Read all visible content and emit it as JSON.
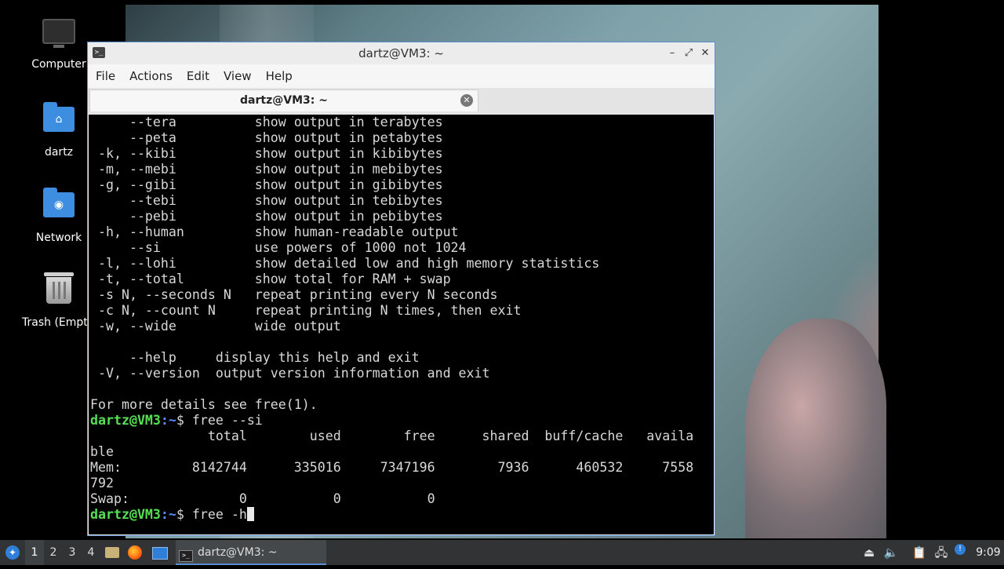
{
  "desktop": {
    "icons": [
      {
        "label": "Computer"
      },
      {
        "label": "dartz"
      },
      {
        "label": "Network"
      },
      {
        "label": "Trash (Empty)"
      }
    ]
  },
  "window": {
    "title": "dartz@VM3: ~",
    "menu": [
      "File",
      "Actions",
      "Edit",
      "View",
      "Help"
    ],
    "tab_label": "dartz@VM3: ~",
    "controls": {
      "minimize": "–",
      "maximize": "⤢",
      "close": "✕"
    }
  },
  "terminal": {
    "prompt_user": "dartz@VM3",
    "prompt_path": ":~",
    "lines": [
      "     --tera          show output in terabytes",
      "     --peta          show output in petabytes",
      " -k, --kibi          show output in kibibytes",
      " -m, --mebi          show output in mebibytes",
      " -g, --gibi          show output in gibibytes",
      "     --tebi          show output in tebibytes",
      "     --pebi          show output in pebibytes",
      " -h, --human         show human-readable output",
      "     --si            use powers of 1000 not 1024",
      " -l, --lohi          show detailed low and high memory statistics",
      " -t, --total         show total for RAM + swap",
      " -s N, --seconds N   repeat printing every N seconds",
      " -c N, --count N     repeat printing N times, then exit",
      " -w, --wide          wide output",
      "",
      "     --help     display this help and exit",
      " -V, --version  output version information and exit",
      "",
      "For more details see free(1)."
    ],
    "cmd1": "$ free --si",
    "output": [
      "               total        used        free      shared  buff/cache   availa",
      "ble",
      "Mem:         8142744      335016     7347196        7936      460532     7558",
      "792",
      "Swap:              0           0           0"
    ],
    "cmd2": "$ free -h"
  },
  "taskbar": {
    "workspaces": [
      "1",
      "2",
      "3",
      "4"
    ],
    "active_workspace": "1",
    "task_label": "dartz@VM3: ~",
    "clock": "9:09"
  }
}
